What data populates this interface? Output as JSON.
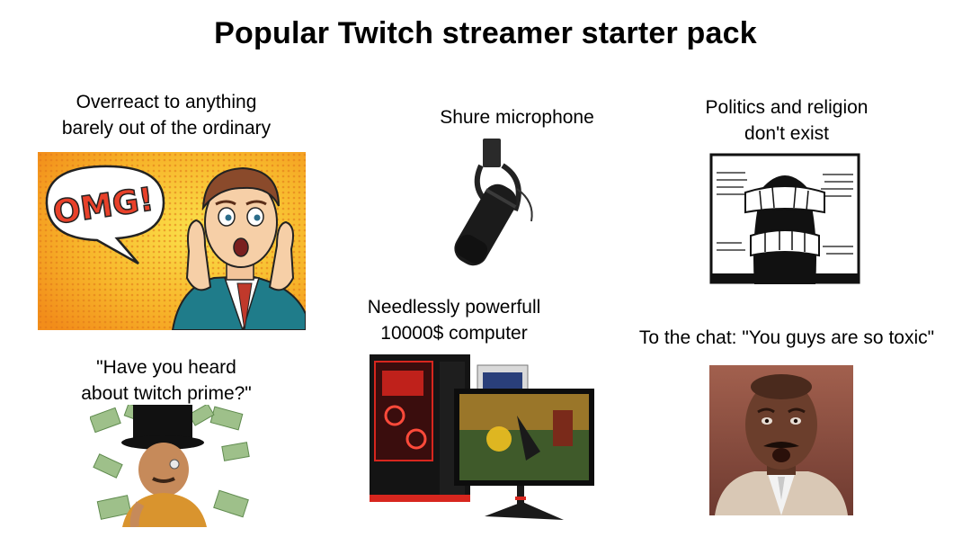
{
  "meme": {
    "title": "Popular Twitch streamer starter pack",
    "items": [
      {
        "caption": "Overreact to anything\nbarely out of the ordinary",
        "image": "omg-popart-man",
        "bubble_text": "OMG!"
      },
      {
        "caption": "Shure microphone",
        "image": "microphone"
      },
      {
        "caption": "Politics and religion\ndon't exist",
        "image": "censored-man-woodcut"
      },
      {
        "caption": "\"Have you heard\nabout twitch prime?\"",
        "image": "rich-man-money-rain"
      },
      {
        "caption": "Needlessly powerfull\n10000$ computer",
        "image": "gaming-pc-and-monitor"
      },
      {
        "caption": "To the chat: \"You guys are so toxic\"",
        "image": "shocked-man"
      }
    ]
  },
  "colors": {
    "popart_orange": "#f6a21b",
    "popart_yellow": "#f8d12a",
    "omg_red": "#e8412a",
    "pc_red": "#d7261e"
  }
}
